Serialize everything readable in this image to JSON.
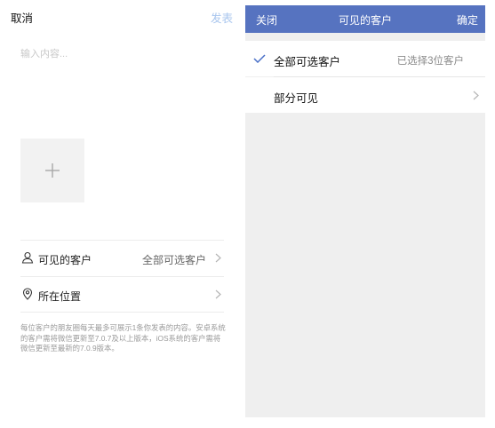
{
  "post": {
    "cancel_label": "取消",
    "publish_label": "发表",
    "compose_placeholder": "输入内容...",
    "visible_customers_label": "可见的客户",
    "visible_customers_value": "全部可选客户",
    "location_label": "所在位置",
    "note": "每位客户的朋友圈每天最多可展示1条你发表的内容。安卓系统的客户需将微信更新至7.0.7及以上版本，iOS系统的客户需将微信更新至最新的7.0.9版本。"
  },
  "picker": {
    "close_label": "关闭",
    "title": "可见的客户",
    "confirm_label": "确定",
    "options": [
      {
        "label": "全部可选客户",
        "value": "已选择3位客户",
        "selected": true
      },
      {
        "label": "部分可见",
        "value": "",
        "selected": false
      }
    ]
  },
  "colors": {
    "header_bar": "#5673c0",
    "accent_check": "#4a70c8",
    "publish_disabled": "#a9c6ee"
  },
  "icons": [
    "plus-icon",
    "person-icon",
    "location-pin-icon",
    "chevron-right-icon",
    "checkmark-icon"
  ]
}
